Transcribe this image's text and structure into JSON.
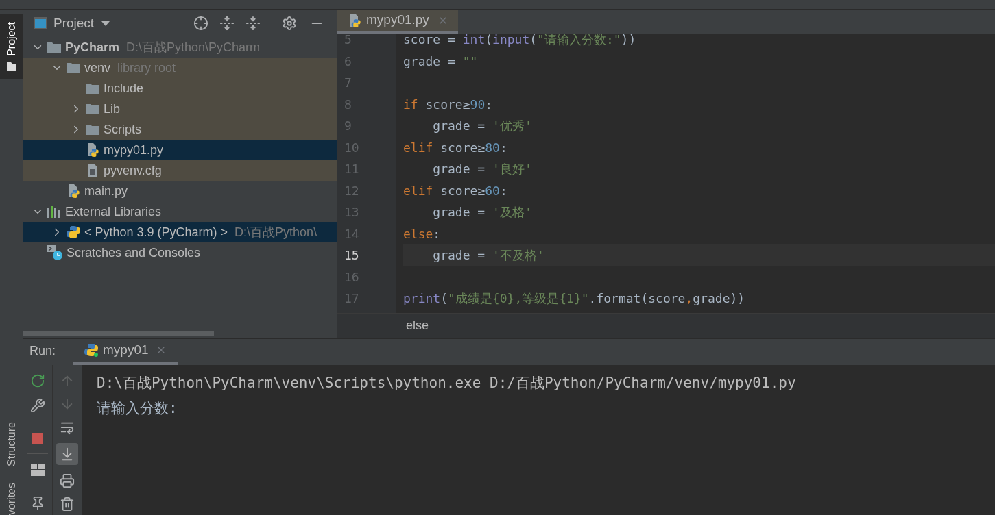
{
  "tool_windows": [
    {
      "label": "Project",
      "selected": true
    },
    {
      "label": "Structure",
      "selected": false
    },
    {
      "label": "vorites",
      "selected": false
    }
  ],
  "project": {
    "title": "Project",
    "tree": [
      {
        "label": "PyCharm",
        "hint": "D:\\百战Python\\PyCharm",
        "kind": "folder",
        "bold": true,
        "expanded": true,
        "highlighted": false,
        "selected": false,
        "children": [
          {
            "label": "venv",
            "hint": "library root",
            "kind": "folder",
            "expanded": true,
            "highlighted": true,
            "selected": false,
            "children": [
              {
                "label": "Include",
                "kind": "folder",
                "highlighted": true,
                "selected": false
              },
              {
                "label": "Lib",
                "kind": "folder",
                "expanded": false,
                "highlighted": true,
                "selected": false
              },
              {
                "label": "Scripts",
                "kind": "folder",
                "expanded": false,
                "highlighted": true,
                "selected": false
              },
              {
                "label": "mypy01.py",
                "kind": "python-file",
                "highlighted": true,
                "selected": true
              },
              {
                "label": "pyvenv.cfg",
                "kind": "text-file",
                "highlighted": true,
                "selected": false
              }
            ]
          },
          {
            "label": "main.py",
            "kind": "python-file",
            "highlighted": false,
            "selected": false
          }
        ]
      },
      {
        "label": "External Libraries",
        "kind": "libraries",
        "expanded": true,
        "highlighted": false,
        "selected": false,
        "children": [
          {
            "label": "< Python 3.9 (PyCharm) >",
            "hint": "D:\\百战Python\\",
            "kind": "python-sdk",
            "expanded": false,
            "selected": true
          }
        ]
      },
      {
        "label": "Scratches and Consoles",
        "kind": "scratches",
        "highlighted": false,
        "selected": false
      }
    ]
  },
  "editor": {
    "tabs": [
      {
        "label": "mypy01.py",
        "selected": true
      }
    ],
    "lines": [
      {
        "number": "5",
        "current": false,
        "tokens": [
          {
            "kind": "plain",
            "text": "score = "
          },
          {
            "kind": "builtin",
            "text": "int"
          },
          {
            "kind": "plain",
            "text": "("
          },
          {
            "kind": "builtin",
            "text": "input"
          },
          {
            "kind": "plain",
            "text": "("
          },
          {
            "kind": "string",
            "text": "\"请输入分数:\""
          },
          {
            "kind": "plain",
            "text": "))"
          }
        ]
      },
      {
        "number": "6",
        "current": false,
        "tokens": [
          {
            "kind": "plain",
            "text": "grade = "
          },
          {
            "kind": "string",
            "text": "\"\""
          }
        ]
      },
      {
        "number": "7",
        "current": false
      },
      {
        "number": "8",
        "current": false,
        "tokens": [
          {
            "kind": "keyword",
            "text": "if"
          },
          {
            "kind": "plain",
            "text": " score≥"
          },
          {
            "kind": "number",
            "text": "90"
          },
          {
            "kind": "plain",
            "text": ":"
          }
        ]
      },
      {
        "number": "9",
        "current": false,
        "tokens": [
          {
            "kind": "plain",
            "text": "    grade = "
          },
          {
            "kind": "string",
            "text": "'优秀'"
          }
        ]
      },
      {
        "number": "10",
        "current": false,
        "tokens": [
          {
            "kind": "keyword",
            "text": "elif"
          },
          {
            "kind": "plain",
            "text": " score≥"
          },
          {
            "kind": "number",
            "text": "80"
          },
          {
            "kind": "plain",
            "text": ":"
          }
        ]
      },
      {
        "number": "11",
        "current": false,
        "tokens": [
          {
            "kind": "plain",
            "text": "    grade = "
          },
          {
            "kind": "string",
            "text": "'良好'"
          }
        ]
      },
      {
        "number": "12",
        "current": false,
        "tokens": [
          {
            "kind": "keyword",
            "text": "elif"
          },
          {
            "kind": "plain",
            "text": " score≥"
          },
          {
            "kind": "number",
            "text": "60"
          },
          {
            "kind": "plain",
            "text": ":"
          }
        ]
      },
      {
        "number": "13",
        "current": false,
        "tokens": [
          {
            "kind": "plain",
            "text": "    grade = "
          },
          {
            "kind": "string",
            "text": "'及格'"
          }
        ]
      },
      {
        "number": "14",
        "current": false,
        "tokens": [
          {
            "kind": "keyword",
            "text": "else"
          },
          {
            "kind": "plain",
            "text": ":"
          }
        ]
      },
      {
        "number": "15",
        "current": true,
        "tokens": [
          {
            "kind": "plain",
            "text": "    grade = "
          },
          {
            "kind": "string",
            "text": "'不及格'"
          }
        ]
      },
      {
        "number": "16",
        "current": false
      },
      {
        "number": "17",
        "current": false,
        "tokens": [
          {
            "kind": "builtin",
            "text": "print"
          },
          {
            "kind": "plain",
            "text": "("
          },
          {
            "kind": "string",
            "text": "\"成绩是{0},等级是{1}\""
          },
          {
            "kind": "plain",
            "text": ".format(score"
          },
          {
            "kind": "keyword",
            "text": ","
          },
          {
            "kind": "plain",
            "text": "grade))"
          }
        ]
      }
    ],
    "breadcrumb": "else"
  },
  "run": {
    "label": "Run:",
    "tabs": [
      {
        "label": "mypy01",
        "selected": true
      }
    ],
    "console": [
      {
        "kind": "command",
        "text": "D:\\百战Python\\PyCharm\\venv\\Scripts\\python.exe D:/百战Python/PyCharm/venv/mypy01.py"
      },
      {
        "kind": "output",
        "text": "请输入分数:"
      }
    ]
  }
}
